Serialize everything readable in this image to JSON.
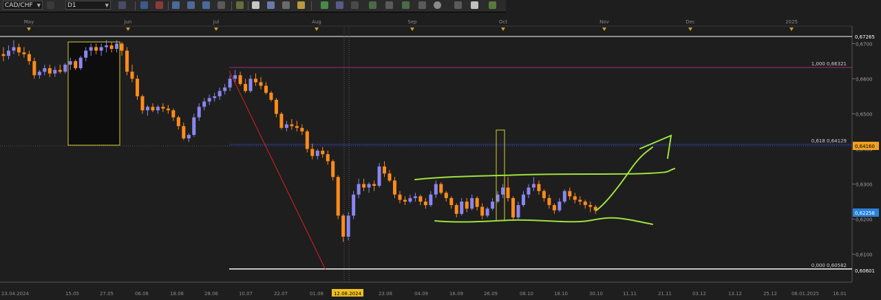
{
  "toolbar": {
    "symbol": "CAD/CHF",
    "timeframe": "D1"
  },
  "months": [
    "May",
    "Jun",
    "Jul",
    "Aug",
    "Sep",
    "Oct",
    "Nov",
    "Dec",
    "2025"
  ],
  "dates": [
    "23.04.2024",
    "15.05",
    "27.05",
    "06.06",
    "18.06",
    "28.06",
    "10.07",
    "22.07",
    "01.08",
    "12.08.2024",
    "23.08",
    "04.09",
    "16.09",
    "26.09",
    "08.10",
    "18.10",
    "30.10",
    "11.11",
    "21.11",
    "03.12",
    "13.12",
    "25.12",
    "06.01.2025",
    "16.01"
  ],
  "price_ticks": [
    "0,6700",
    "0,6600",
    "0,6500",
    "0,6400",
    "0,6300",
    "0,6200",
    "0,6100"
  ],
  "price_top": "0,67265",
  "price_bottom": "0,60601",
  "price_marker": "0,64160",
  "price_current": "0,62258",
  "fib_levels": [
    {
      "label": "1,000 0,66321",
      "price": 0.66321,
      "color": "#a0307a"
    },
    {
      "label": "0,618 0,64129",
      "price": 0.64129,
      "color": "#2a3aa8"
    },
    {
      "label": "0,000 0,60582",
      "price": 0.60582,
      "color": "#ffffff"
    }
  ],
  "colors": {
    "bull": "#8a86f0",
    "bear": "#ff8c1a",
    "trendline": "#e02020",
    "annotation": "#9ee63a",
    "highlight_box": "#d8d030",
    "current_price_bg": "#2a82d8",
    "marker_price_bg": "#f0a020"
  },
  "chart_data": {
    "type": "candlestick",
    "symbol": "CAD/CHF",
    "timeframe": "D1",
    "ylim": [
      0.605,
      0.674
    ],
    "candles": [
      [
        0.667,
        0.669,
        0.665,
        0.6665
      ],
      [
        0.6665,
        0.6695,
        0.6655,
        0.668
      ],
      [
        0.668,
        0.671,
        0.667,
        0.669
      ],
      [
        0.669,
        0.67,
        0.6665,
        0.6675
      ],
      [
        0.6675,
        0.669,
        0.666,
        0.667
      ],
      [
        0.667,
        0.668,
        0.664,
        0.665
      ],
      [
        0.665,
        0.666,
        0.66,
        0.661
      ],
      [
        0.661,
        0.6625,
        0.66,
        0.662
      ],
      [
        0.662,
        0.664,
        0.661,
        0.663
      ],
      [
        0.663,
        0.664,
        0.6605,
        0.6615
      ],
      [
        0.6615,
        0.6635,
        0.6605,
        0.6625
      ],
      [
        0.6625,
        0.664,
        0.6615,
        0.662
      ],
      [
        0.662,
        0.6645,
        0.6615,
        0.664
      ],
      [
        0.664,
        0.666,
        0.6625,
        0.665
      ],
      [
        0.665,
        0.6655,
        0.6625,
        0.663
      ],
      [
        0.663,
        0.6665,
        0.6625,
        0.666
      ],
      [
        0.666,
        0.669,
        0.665,
        0.668
      ],
      [
        0.668,
        0.67,
        0.6665,
        0.669
      ],
      [
        0.669,
        0.67,
        0.667,
        0.668
      ],
      [
        0.668,
        0.67,
        0.6665,
        0.669
      ],
      [
        0.669,
        0.671,
        0.6675,
        0.6695
      ],
      [
        0.6695,
        0.6705,
        0.6675,
        0.6685
      ],
      [
        0.6685,
        0.671,
        0.6675,
        0.67
      ],
      [
        0.67,
        0.6705,
        0.6665,
        0.668
      ],
      [
        0.668,
        0.669,
        0.661,
        0.662
      ],
      [
        0.662,
        0.664,
        0.659,
        0.66
      ],
      [
        0.66,
        0.661,
        0.654,
        0.655
      ],
      [
        0.655,
        0.6555,
        0.65,
        0.651
      ],
      [
        0.651,
        0.6525,
        0.6495,
        0.652
      ],
      [
        0.652,
        0.653,
        0.6505,
        0.651
      ],
      [
        0.651,
        0.6525,
        0.65,
        0.652
      ],
      [
        0.652,
        0.653,
        0.6505,
        0.6515
      ],
      [
        0.6515,
        0.6525,
        0.65,
        0.651
      ],
      [
        0.651,
        0.6515,
        0.648,
        0.649
      ],
      [
        0.649,
        0.6495,
        0.6455,
        0.6465
      ],
      [
        0.6465,
        0.6475,
        0.6425,
        0.643
      ],
      [
        0.643,
        0.6445,
        0.642,
        0.644
      ],
      [
        0.644,
        0.65,
        0.6435,
        0.649
      ],
      [
        0.649,
        0.653,
        0.648,
        0.652
      ],
      [
        0.652,
        0.6545,
        0.651,
        0.6535
      ],
      [
        0.6535,
        0.6555,
        0.6525,
        0.6545
      ],
      [
        0.6545,
        0.656,
        0.6535,
        0.655
      ],
      [
        0.655,
        0.6575,
        0.654,
        0.6565
      ],
      [
        0.6565,
        0.6585,
        0.6555,
        0.6575
      ],
      [
        0.6575,
        0.661,
        0.6565,
        0.66
      ],
      [
        0.66,
        0.6625,
        0.659,
        0.661
      ],
      [
        0.661,
        0.662,
        0.658,
        0.6585
      ],
      [
        0.6585,
        0.66,
        0.656,
        0.6565
      ],
      [
        0.6565,
        0.661,
        0.656,
        0.66
      ],
      [
        0.66,
        0.6615,
        0.658,
        0.659
      ],
      [
        0.659,
        0.6605,
        0.657,
        0.658
      ],
      [
        0.658,
        0.659,
        0.6555,
        0.656
      ],
      [
        0.656,
        0.6565,
        0.6535,
        0.654
      ],
      [
        0.654,
        0.6545,
        0.649,
        0.65
      ],
      [
        0.65,
        0.6505,
        0.6455,
        0.646
      ],
      [
        0.646,
        0.648,
        0.645,
        0.647
      ],
      [
        0.647,
        0.6485,
        0.6455,
        0.6465
      ],
      [
        0.6465,
        0.648,
        0.645,
        0.646
      ],
      [
        0.646,
        0.647,
        0.644,
        0.645
      ],
      [
        0.645,
        0.6455,
        0.639,
        0.64
      ],
      [
        0.64,
        0.6415,
        0.637,
        0.638
      ],
      [
        0.638,
        0.64,
        0.637,
        0.6395
      ],
      [
        0.6395,
        0.6405,
        0.6375,
        0.6385
      ],
      [
        0.6385,
        0.6395,
        0.6355,
        0.6365
      ],
      [
        0.6365,
        0.637,
        0.631,
        0.632
      ],
      [
        0.632,
        0.6325,
        0.62,
        0.621
      ],
      [
        0.621,
        0.6215,
        0.6135,
        0.615
      ],
      [
        0.615,
        0.622,
        0.614,
        0.621
      ],
      [
        0.621,
        0.628,
        0.62,
        0.627
      ],
      [
        0.627,
        0.6315,
        0.626,
        0.63
      ],
      [
        0.63,
        0.6315,
        0.628,
        0.629
      ],
      [
        0.629,
        0.6305,
        0.6275,
        0.63
      ],
      [
        0.63,
        0.631,
        0.628,
        0.6295
      ],
      [
        0.6295,
        0.636,
        0.629,
        0.635
      ],
      [
        0.635,
        0.6365,
        0.632,
        0.633
      ],
      [
        0.633,
        0.634,
        0.6305,
        0.631
      ],
      [
        0.631,
        0.632,
        0.626,
        0.627
      ],
      [
        0.627,
        0.628,
        0.6245,
        0.6255
      ],
      [
        0.6255,
        0.6265,
        0.624,
        0.625
      ],
      [
        0.625,
        0.627,
        0.6245,
        0.626
      ],
      [
        0.626,
        0.6275,
        0.625,
        0.6265
      ],
      [
        0.6265,
        0.627,
        0.624,
        0.625
      ],
      [
        0.625,
        0.626,
        0.623,
        0.624
      ],
      [
        0.624,
        0.628,
        0.6235,
        0.627
      ],
      [
        0.627,
        0.631,
        0.626,
        0.63
      ],
      [
        0.63,
        0.6305,
        0.627,
        0.6275
      ],
      [
        0.6275,
        0.628,
        0.625,
        0.626
      ],
      [
        0.626,
        0.6265,
        0.623,
        0.624
      ],
      [
        0.624,
        0.6245,
        0.6205,
        0.6215
      ],
      [
        0.6215,
        0.626,
        0.621,
        0.625
      ],
      [
        0.625,
        0.626,
        0.622,
        0.623
      ],
      [
        0.623,
        0.627,
        0.6225,
        0.626
      ],
      [
        0.626,
        0.6265,
        0.6225,
        0.6235
      ],
      [
        0.6235,
        0.6245,
        0.62,
        0.621
      ],
      [
        0.621,
        0.6235,
        0.6205,
        0.623
      ],
      [
        0.623,
        0.626,
        0.6225,
        0.625
      ],
      [
        0.625,
        0.628,
        0.6245,
        0.627
      ],
      [
        0.627,
        0.63,
        0.626,
        0.629
      ],
      [
        0.629,
        0.632,
        0.625,
        0.626
      ],
      [
        0.626,
        0.6265,
        0.6195,
        0.6205
      ],
      [
        0.6205,
        0.625,
        0.62,
        0.624
      ],
      [
        0.624,
        0.628,
        0.6235,
        0.627
      ],
      [
        0.627,
        0.63,
        0.626,
        0.629
      ],
      [
        0.629,
        0.632,
        0.628,
        0.63
      ],
      [
        0.63,
        0.631,
        0.627,
        0.628
      ],
      [
        0.628,
        0.6285,
        0.625,
        0.626
      ],
      [
        0.626,
        0.627,
        0.623,
        0.624
      ],
      [
        0.624,
        0.6245,
        0.6215,
        0.6225
      ],
      [
        0.6225,
        0.626,
        0.622,
        0.625
      ],
      [
        0.625,
        0.6285,
        0.6245,
        0.628
      ],
      [
        0.628,
        0.629,
        0.6255,
        0.6265
      ],
      [
        0.6265,
        0.6275,
        0.6245,
        0.6255
      ],
      [
        0.6255,
        0.6265,
        0.624,
        0.625
      ],
      [
        0.625,
        0.6255,
        0.623,
        0.624
      ],
      [
        0.624,
        0.625,
        0.622,
        0.6235
      ],
      [
        0.6235,
        0.624,
        0.6215,
        0.6225
      ]
    ]
  }
}
